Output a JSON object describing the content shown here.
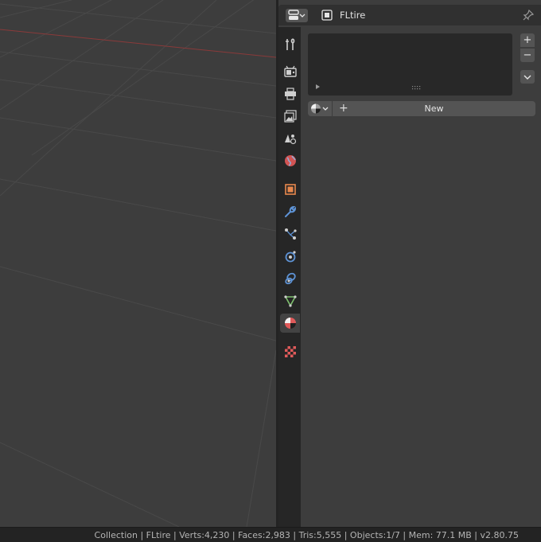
{
  "properties": {
    "context_name": "FLtire",
    "material_slots": [],
    "new_label": "New",
    "add_slot_symbol": "+",
    "remove_slot_symbol": "−",
    "new_plus_symbol": "+"
  },
  "tabs": [
    {
      "name": "tool-tab",
      "icon": "tool-icon"
    },
    {
      "name": "render-tab",
      "icon": "render-icon"
    },
    {
      "name": "output-tab",
      "icon": "printer-icon"
    },
    {
      "name": "view-layer-tab",
      "icon": "image-icon"
    },
    {
      "name": "scene-tab",
      "icon": "scene-icon"
    },
    {
      "name": "world-tab",
      "icon": "world-icon"
    },
    {
      "name": "object-tab",
      "icon": "object-icon"
    },
    {
      "name": "modifier-tab",
      "icon": "wrench-icon"
    },
    {
      "name": "particles-tab",
      "icon": "particles-icon"
    },
    {
      "name": "physics-tab",
      "icon": "physics-icon"
    },
    {
      "name": "constraints-tab",
      "icon": "constraint-icon"
    },
    {
      "name": "data-tab",
      "icon": "mesh-data-icon"
    },
    {
      "name": "material-tab",
      "icon": "material-icon",
      "active": true
    },
    {
      "name": "texture-tab",
      "icon": "checker-texture-icon"
    }
  ],
  "colors": {
    "accent_active_tab": "#e05a5a",
    "object_orange": "#e8884d",
    "modifier_blue": "#5e93d6",
    "data_green": "#7ec06e",
    "viewport_bg": "#3d3d3d",
    "x_axis_red": "#8a3a3a"
  },
  "status_bar": {
    "text": "Collection | FLtire | Verts:4,230 | Faces:2,983 | Tris:5,555 | Objects:1/7 | Mem: 77.1 MB | v2.80.75"
  }
}
